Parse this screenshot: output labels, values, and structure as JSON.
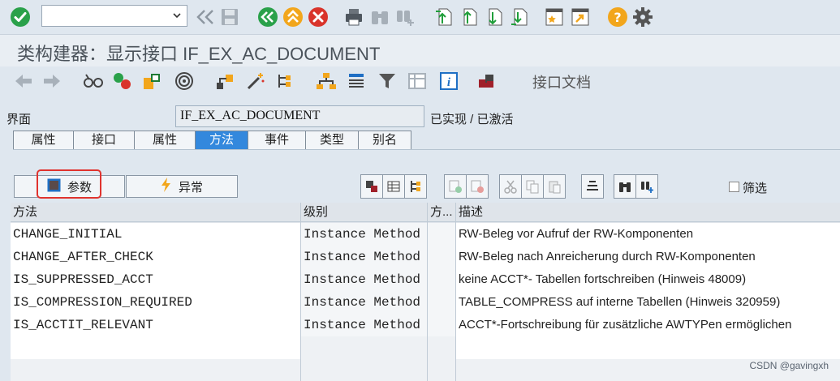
{
  "command_field": {
    "value": "",
    "placeholder": ""
  },
  "title": "类构建器：显示接口 IF_EX_AC_DOCUMENT",
  "app_toolbar": {
    "doc_label": "接口文档"
  },
  "header": {
    "interface_label": "界面",
    "interface_value": "IF_EX_AC_DOCUMENT",
    "status": "已实现 / 已激活"
  },
  "tabs": [
    {
      "label": "属性",
      "active": false
    },
    {
      "label": "接口",
      "active": false
    },
    {
      "label": "属性",
      "active": false
    },
    {
      "label": "方法",
      "active": true
    },
    {
      "label": "事件",
      "active": false
    },
    {
      "label": "类型",
      "active": false
    },
    {
      "label": "别名",
      "active": false
    }
  ],
  "sub_tabs": {
    "params": "参数",
    "exceptions": "异常"
  },
  "filter_label": "筛选",
  "table": {
    "columns": [
      "方法",
      "级别",
      "方...",
      "描述"
    ],
    "rows": [
      {
        "method": "CHANGE_INITIAL",
        "level": "Instance Method",
        "dir": "",
        "desc": "RW-Beleg vor Aufruf der RW-Komponenten"
      },
      {
        "method": "CHANGE_AFTER_CHECK",
        "level": "Instance Method",
        "dir": "",
        "desc": "RW-Beleg nach Anreicherung durch RW-Komponenten"
      },
      {
        "method": "IS_SUPPRESSED_ACCT",
        "level": "Instance Method",
        "dir": "",
        "desc": "keine ACCT*- Tabellen fortschreiben (Hinweis 48009)"
      },
      {
        "method": "IS_COMPRESSION_REQUIRED",
        "level": "Instance Method",
        "dir": "",
        "desc": "TABLE_COMPRESS auf interne Tabellen (Hinweis 320959)"
      },
      {
        "method": "IS_ACCTIT_RELEVANT",
        "level": "Instance Method",
        "dir": "",
        "desc": "ACCT*-Fortschreibung für zusätzliche AWTYPen ermöglichen"
      }
    ]
  },
  "watermark": "CSDN @gavingxh",
  "colors": {
    "active_tab": "#3388dd",
    "highlight": "#e0332e",
    "ok_green": "#2aa14a",
    "cancel_red": "#d9342b",
    "back_yellow": "#f2a61c"
  }
}
